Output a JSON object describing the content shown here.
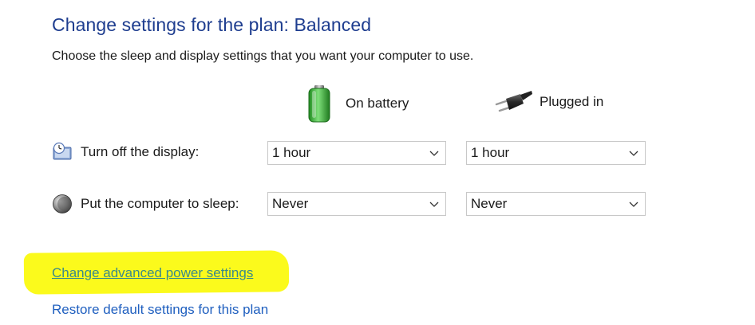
{
  "header": {
    "title": "Change settings for the plan: Balanced",
    "subtitle": "Choose the sleep and display settings that you want your computer to use."
  },
  "columns": {
    "battery": {
      "label": "On battery",
      "icon": "battery-icon"
    },
    "plugged": {
      "label": "Plugged in",
      "icon": "power-plug-icon"
    }
  },
  "rows": {
    "display": {
      "label": "Turn off the display:",
      "icon": "display-clock-icon",
      "battery_value": "1 hour",
      "plugged_value": "1 hour"
    },
    "sleep": {
      "label": "Put the computer to sleep:",
      "icon": "sleep-moon-icon",
      "battery_value": "Never",
      "plugged_value": "Never"
    }
  },
  "links": {
    "advanced": "Change advanced power settings",
    "restore": "Restore default settings for this plan"
  },
  "colors": {
    "title": "#1e3d8f",
    "link": "#1f5fbf",
    "highlight": "#fbfa1c",
    "battery_green": "#3fb93f"
  }
}
